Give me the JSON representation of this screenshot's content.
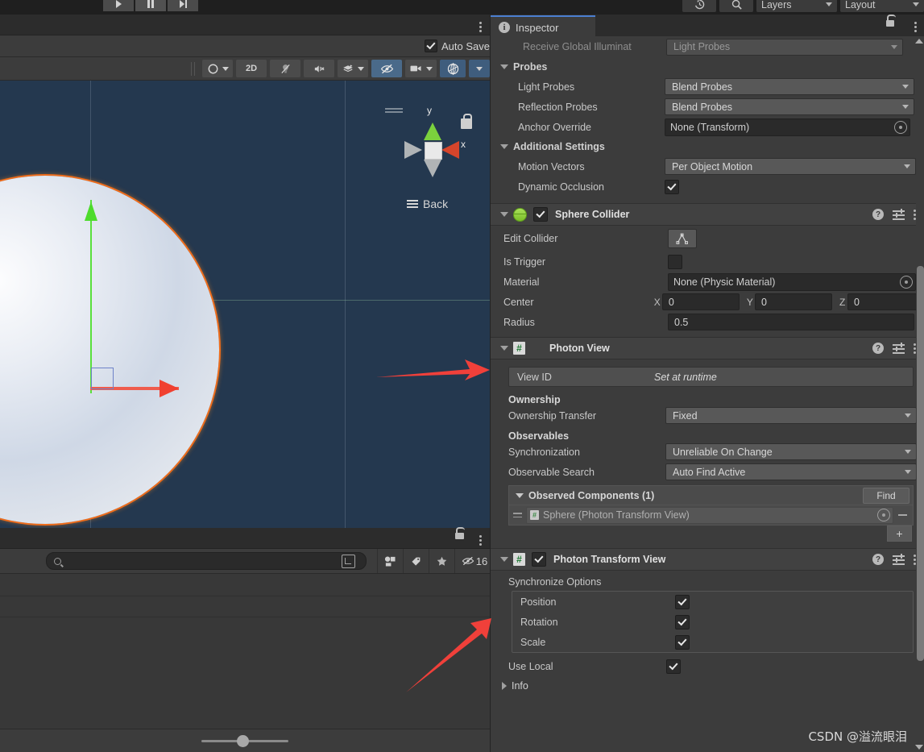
{
  "app": {
    "watermark": "CSDN @溢流眼泪"
  },
  "toolbar": {
    "play_label": "play-icon",
    "pause_label": "pause-icon",
    "step_label": "step-icon",
    "history_icon": "history-icon",
    "search_icon": "search-icon",
    "layers": "Layers",
    "layout": "Layout"
  },
  "scene_panel": {
    "autosave_label": "Auto Save",
    "autosave_checked": true,
    "toolbar_buttons": [
      {
        "name": "shading-mode",
        "label": "",
        "icon": "sphere-shading-icon",
        "has_caret": true,
        "selected": false
      },
      {
        "name": "2d-toggle",
        "label": "2D",
        "icon": "",
        "has_caret": false,
        "selected": false
      },
      {
        "name": "lighting-toggle",
        "label": "",
        "icon": "light-off-icon",
        "has_caret": false,
        "selected": false
      },
      {
        "name": "audio-toggle",
        "label": "",
        "icon": "audio-mute-icon",
        "has_caret": false,
        "selected": false
      },
      {
        "name": "fx-toggle",
        "label": "",
        "icon": "effects-icon",
        "has_caret": true,
        "selected": false
      },
      {
        "name": "hidden-objects-toggle",
        "label": "",
        "icon": "eye-off-icon",
        "has_caret": false,
        "selected": true
      },
      {
        "name": "camera-settings",
        "label": "",
        "icon": "camera-icon",
        "has_caret": true,
        "selected": false
      },
      {
        "name": "gizmos-toggle",
        "label": "",
        "icon": "gizmos-globe-icon",
        "has_caret": true,
        "selected": true
      }
    ],
    "gizmo": {
      "axis_y": "y",
      "axis_x": "x",
      "view_label": "Back"
    }
  },
  "lower_panel": {
    "search_placeholder": "",
    "search_value": "",
    "hidden_count": "16"
  },
  "inspector": {
    "tab_label": "Inspector",
    "renderer_tail": {
      "receive_gi_label": "Receive Global Illuminat",
      "receive_gi_value": "Light Probes"
    },
    "probes": {
      "section_label": "Probes",
      "rows": [
        {
          "label": "Light Probes",
          "value": "Blend Probes",
          "kind": "dropdown"
        },
        {
          "label": "Reflection Probes",
          "value": "Blend Probes",
          "kind": "dropdown"
        },
        {
          "label": "Anchor Override",
          "value": "None (Transform)",
          "kind": "object"
        }
      ]
    },
    "additional_settings": {
      "section_label": "Additional Settings",
      "motion_vectors_label": "Motion Vectors",
      "motion_vectors_value": "Per Object Motion",
      "dynamic_occlusion_label": "Dynamic Occlusion",
      "dynamic_occlusion_checked": true
    },
    "sphere_collider": {
      "title": "Sphere Collider",
      "enabled": true,
      "edit_collider_label": "Edit Collider",
      "is_trigger_label": "Is Trigger",
      "is_trigger_checked": false,
      "material_label": "Material",
      "material_value": "None (Physic Material)",
      "center_label": "Center",
      "center": {
        "x_label": "X",
        "x": "0",
        "y_label": "Y",
        "y": "0",
        "z_label": "Z",
        "z": "0"
      },
      "radius_label": "Radius",
      "radius": "0.5"
    },
    "photon_view": {
      "title": "Photon View",
      "view_id_label": "View ID",
      "view_id_value": "Set at runtime",
      "ownership_header": "Ownership",
      "ownership_transfer_label": "Ownership Transfer",
      "ownership_transfer_value": "Fixed",
      "observables_header": "Observables",
      "synchronization_label": "Synchronization",
      "synchronization_value": "Unreliable On Change",
      "observable_search_label": "Observable Search",
      "observable_search_value": "Auto Find Active",
      "observed_components_header": "Observed Components (1)",
      "find_button": "Find",
      "observed_items": [
        {
          "name": "Sphere (Photon Transform View)"
        }
      ],
      "add_button": "+",
      "remove_button": "−"
    },
    "photon_transform_view": {
      "title": "Photon Transform View",
      "enabled": true,
      "sync_options_label": "Synchronize Options",
      "options": [
        {
          "label": "Position",
          "checked": true
        },
        {
          "label": "Rotation",
          "checked": true
        },
        {
          "label": "Scale",
          "checked": true
        }
      ],
      "use_local_label": "Use Local",
      "use_local_checked": true,
      "info_label": "Info"
    }
  },
  "colors": {
    "accent_tab": "#4b7fd1",
    "scene_bg": "#24384f",
    "panel_bg": "#3c3c3c",
    "selection_outline": "#f06c1a",
    "annotation_arrow": "#f0403a",
    "axis_x": "#ef5c4d",
    "axis_y": "#59e03c"
  }
}
